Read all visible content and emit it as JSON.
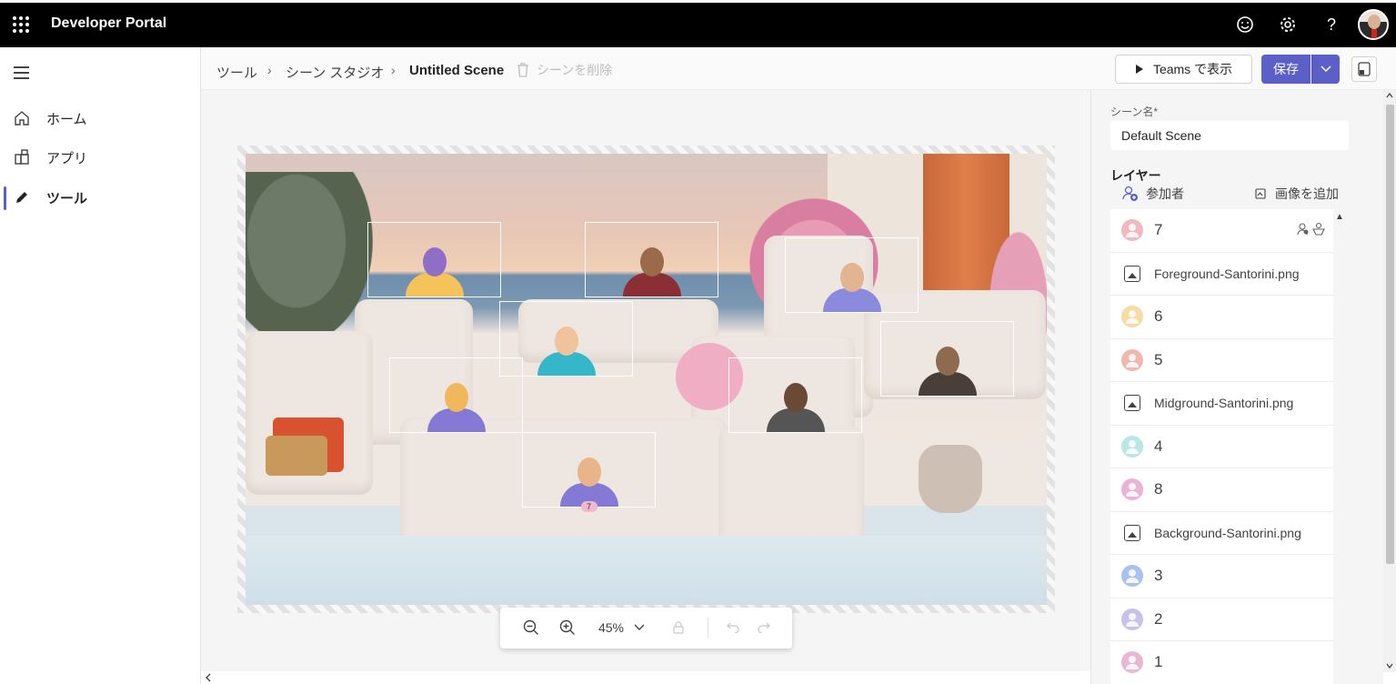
{
  "topbar": {
    "title": "Developer Portal"
  },
  "nav": {
    "items": [
      {
        "label": "ホーム"
      },
      {
        "label": "アプリ"
      },
      {
        "label": "ツール"
      }
    ]
  },
  "breadcrumb": {
    "items": [
      "ツール",
      "シーン スタジオ",
      "Untitled Scene"
    ]
  },
  "toolbar": {
    "delete_label": "シーンを削除",
    "teams_label": "Teams で表示",
    "save_label": "保存"
  },
  "scene": {
    "badge": "7"
  },
  "zoom": {
    "level": "45%"
  },
  "panel": {
    "scene_name_label": "シーン名*",
    "scene_name_value": "Default Scene",
    "layers_title": "レイヤー",
    "add_participant_label": "参加者",
    "add_image_label": "画像を追加",
    "layers": [
      {
        "type": "participant",
        "label": "7",
        "color": "#f0b8bf"
      },
      {
        "type": "image",
        "label": "Foreground-Santorini.png"
      },
      {
        "type": "participant",
        "label": "6",
        "color": "#f6dca2"
      },
      {
        "type": "participant",
        "label": "5",
        "color": "#efb7ad"
      },
      {
        "type": "image",
        "label": "Midground-Santorini.png"
      },
      {
        "type": "participant",
        "label": "4",
        "color": "#b9e6e8"
      },
      {
        "type": "participant",
        "label": "8",
        "color": "#e9b3d6"
      },
      {
        "type": "image",
        "label": "Background-Santorini.png"
      },
      {
        "type": "participant",
        "label": "3",
        "color": "#a9c1ec"
      },
      {
        "type": "participant",
        "label": "2",
        "color": "#c8c2eb"
      },
      {
        "type": "participant",
        "label": "1",
        "color": "#e8b7d4"
      }
    ]
  }
}
